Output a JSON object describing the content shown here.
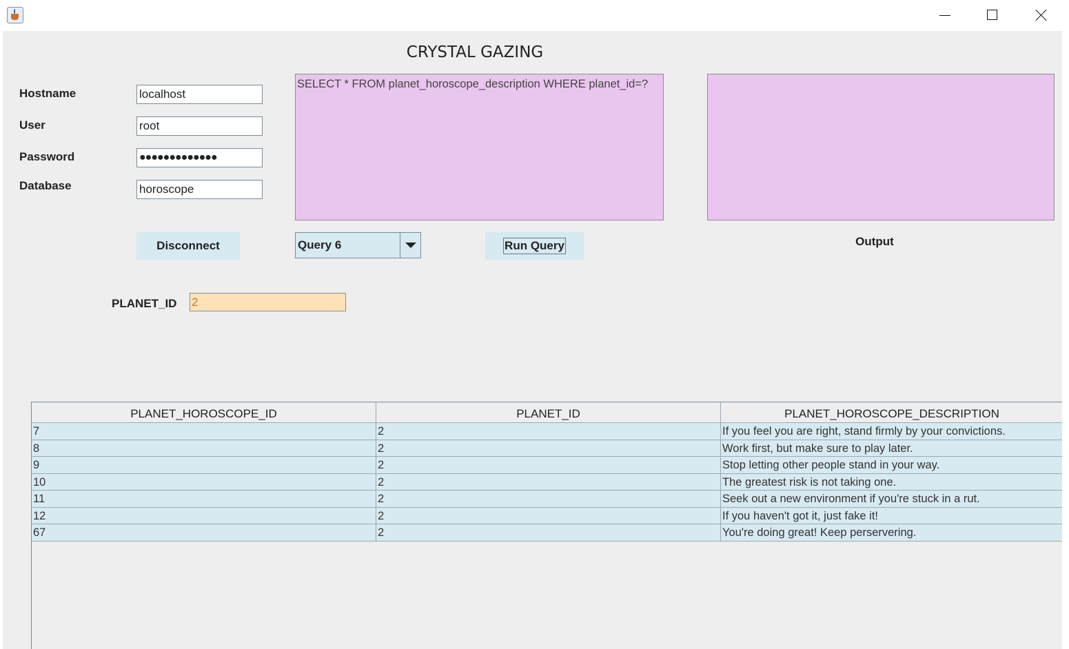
{
  "window": {
    "app_icon": "java-coffee-cup-icon",
    "controls": [
      "minimize-icon",
      "maximize-icon",
      "close-icon"
    ]
  },
  "app": {
    "title": "CRYSTAL GAZING"
  },
  "connection": {
    "hostname_label": "Hostname",
    "hostname_value": "localhost",
    "user_label": "User",
    "user_value": "root",
    "password_label": "Password",
    "password_mask": "●●●●●●●●●●●●●",
    "database_label": "Database",
    "database_value": "horoscope",
    "disconnect_label": "Disconnect"
  },
  "query": {
    "text": "SELECT * FROM planet_horoscope_description WHERE planet_id=?",
    "selected": "Query 6",
    "run_label": "Run Query"
  },
  "output": {
    "label": "Output",
    "text": ""
  },
  "parameter": {
    "label": "PLANET_ID",
    "value": "2"
  },
  "results": {
    "columns": [
      "PLANET_HOROSCOPE_ID",
      "PLANET_ID",
      "PLANET_HOROSCOPE_DESCRIPTION"
    ],
    "rows": [
      [
        "7",
        "2",
        "If you feel you are right, stand firmly by your convictions."
      ],
      [
        "8",
        "2",
        "Work first, but make sure to play later."
      ],
      [
        "9",
        "2",
        "Stop letting other people stand in your way."
      ],
      [
        "10",
        "2",
        "The greatest risk is not taking one."
      ],
      [
        "11",
        "2",
        "Seek out a new environment if you're stuck in a rut."
      ],
      [
        "12",
        "2",
        "If you haven't got it, just fake it!"
      ],
      [
        "67",
        "2",
        "You're doing great! Keep perservering."
      ]
    ]
  },
  "colors": {
    "text_area_bg": "#e9c6ed",
    "button_bg": "#d7e9f1",
    "param_field_bg": "#ffe2b8",
    "table_row_bg": "#d8eaf1",
    "panel_bg": "#eeeeee"
  }
}
